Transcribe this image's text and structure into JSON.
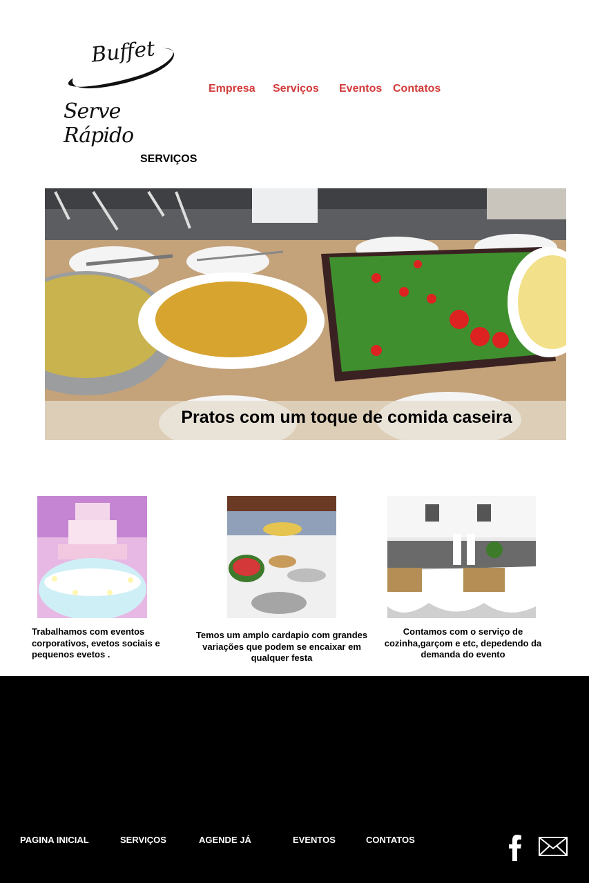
{
  "logo": {
    "line1": "Buffet",
    "line2": "Serve Rápido"
  },
  "nav": {
    "empresa": "Empresa",
    "servicos": "Serviços",
    "eventos": "Eventos",
    "contatos": "Contatos"
  },
  "section_title": "SERVIÇOS",
  "hero": {
    "caption": "Pratos com um toque de comida caseira"
  },
  "cards": [
    {
      "text": "Trabalhamos com  eventos corporativos, evetos sociais e pequenos evetos ."
    },
    {
      "text": "Temos um amplo cardapio com grandes variações que podem se encaixar em qualquer festa"
    },
    {
      "text": "Contamos com o serviço de cozinha,garçom e etc, depedendo da demanda do evento"
    }
  ],
  "footer": {
    "links": [
      "PAGINA INICIAL",
      "SERVIÇOS",
      "AGENDE JÁ",
      "EVENTOS",
      "CONTATOS"
    ]
  },
  "colors": {
    "nav": "#d23b3b",
    "footer_bg": "#000000"
  }
}
